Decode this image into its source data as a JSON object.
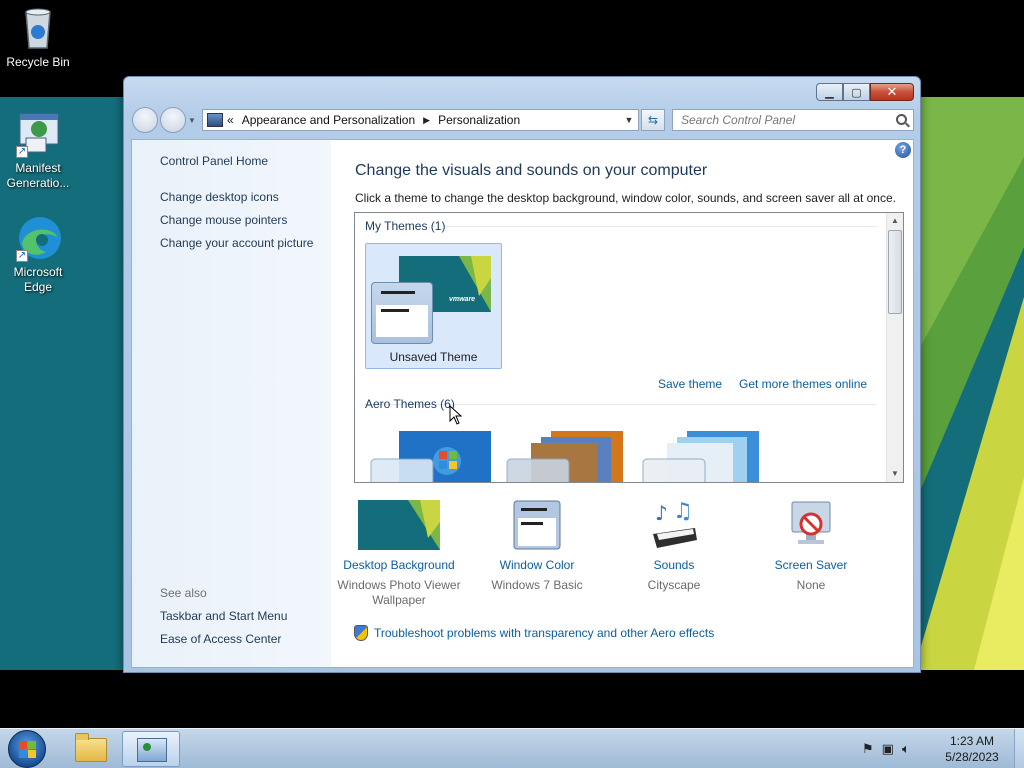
{
  "desktop": {
    "icons": [
      {
        "label": "Recycle Bin"
      },
      {
        "label": "Manifest Generatio..."
      },
      {
        "label": "Microsoft Edge"
      }
    ]
  },
  "window": {
    "breadcrumb": [
      "Appearance and Personalization",
      "Personalization"
    ],
    "breadcrumb_overflow": "«",
    "search_placeholder": "Search Control Panel",
    "help": "?",
    "sidebar": {
      "home": "Control Panel Home",
      "links": [
        "Change desktop icons",
        "Change mouse pointers",
        "Change your account picture"
      ],
      "see_also_heading": "See also",
      "see_also": [
        "Taskbar and Start Menu",
        "Ease of Access Center"
      ]
    },
    "title": "Change the visuals and sounds on your computer",
    "description": "Click a theme to change the desktop background, window color, sounds, and screen saver all at once.",
    "my_themes_heading": "My Themes (1)",
    "unsaved_theme_label": "Unsaved Theme",
    "thumb_brand": "vmware",
    "save_theme": "Save theme",
    "get_more_themes": "Get more themes online",
    "aero_themes_heading": "Aero Themes (6)",
    "options": [
      {
        "name": "Desktop Background",
        "value": "Windows Photo Viewer Wallpaper"
      },
      {
        "name": "Window Color",
        "value": "Windows 7 Basic"
      },
      {
        "name": "Sounds",
        "value": "Cityscape"
      },
      {
        "name": "Screen Saver",
        "value": "None"
      }
    ],
    "troubleshoot": "Troubleshoot problems with transparency and other Aero effects"
  },
  "taskbar": {
    "time": "1:23 AM",
    "date": "5/28/2023"
  },
  "colors": {
    "wallpaper": "#146d7a",
    "link": "#0b5ea3",
    "title": "#1e395b"
  }
}
